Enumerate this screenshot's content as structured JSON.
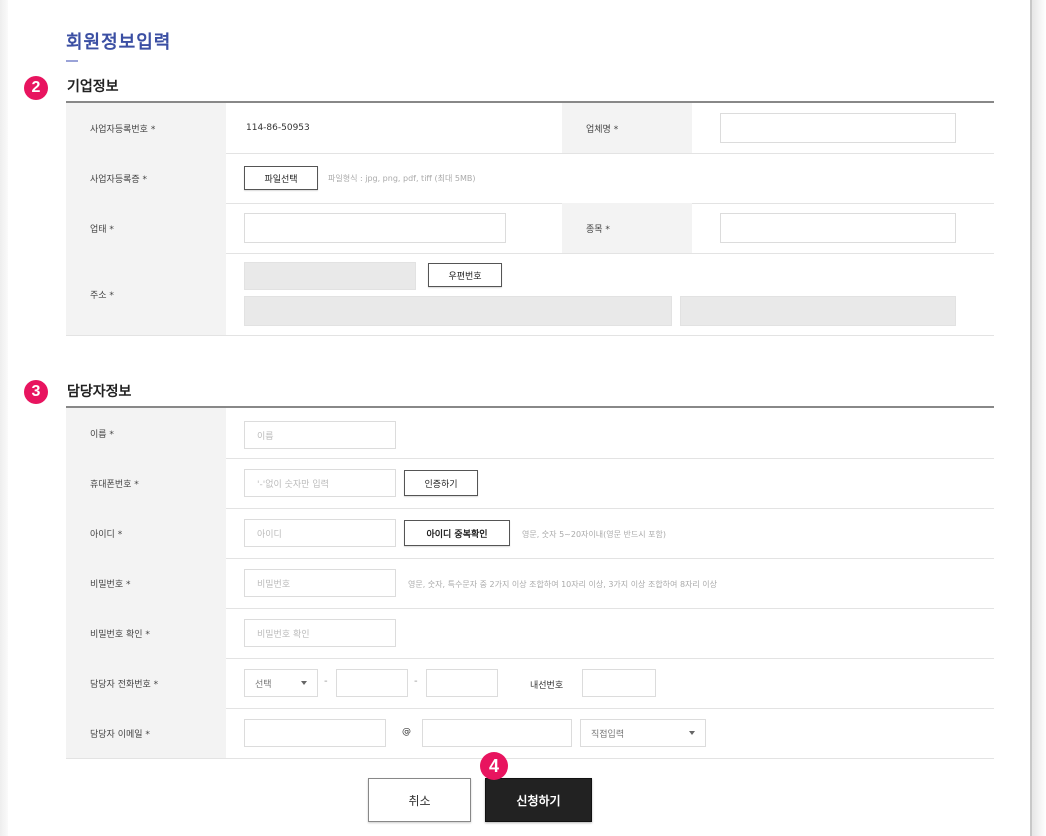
{
  "page": {
    "title": "회원정보입력"
  },
  "markers": {
    "company": "2",
    "manager": "3",
    "submit": "4"
  },
  "company_section": {
    "title": "기업정보",
    "biz_number": {
      "label": "사업자등록번호 *",
      "value": "114-86-50953"
    },
    "company_name": {
      "label": "업체명 *",
      "value": ""
    },
    "biz_certificate": {
      "label": "사업자등록증 *",
      "button": "파일선택",
      "hint": "파일형식 : jpg, png, pdf, tiff (최대 5MB)"
    },
    "biz_type": {
      "label": "업태 *",
      "value": ""
    },
    "biz_item": {
      "label": "종목 *",
      "value": ""
    },
    "address": {
      "label": "주소 *",
      "zip_button": "우편번호"
    }
  },
  "manager_section": {
    "title": "담당자정보",
    "name": {
      "label": "이름 *",
      "placeholder": "이름"
    },
    "mobile": {
      "label": "휴대폰번호 *",
      "placeholder": "'-'없이 숫자만 입력",
      "button": "인증하기"
    },
    "user_id": {
      "label": "아이디 *",
      "placeholder": "아이디",
      "button": "아이디 중복확인",
      "hint": "영문, 숫자 5~20자이내(영문 반드시 포함)"
    },
    "password": {
      "label": "비밀번호 *",
      "placeholder": "비밀번호",
      "hint": "영문, 숫자, 특수문자 중 2가지 이상 조합하여 10자리 이상, 3가지 이상 조합하여 8자리 이상"
    },
    "password_confirm": {
      "label": "비밀번호 확인 *",
      "placeholder": "비밀번호 확인"
    },
    "phone": {
      "label": "담당자 전화번호 *",
      "area_select": "선택",
      "extension_label": "내선번호"
    },
    "email": {
      "label": "담당자 이메일 *",
      "at": "@",
      "domain_select": "직접입력"
    }
  },
  "actions": {
    "cancel": "취소",
    "submit": "신청하기"
  },
  "colors": {
    "marker": "#e8145f",
    "title": "#3b4fa3",
    "submit_bg": "#222222"
  }
}
